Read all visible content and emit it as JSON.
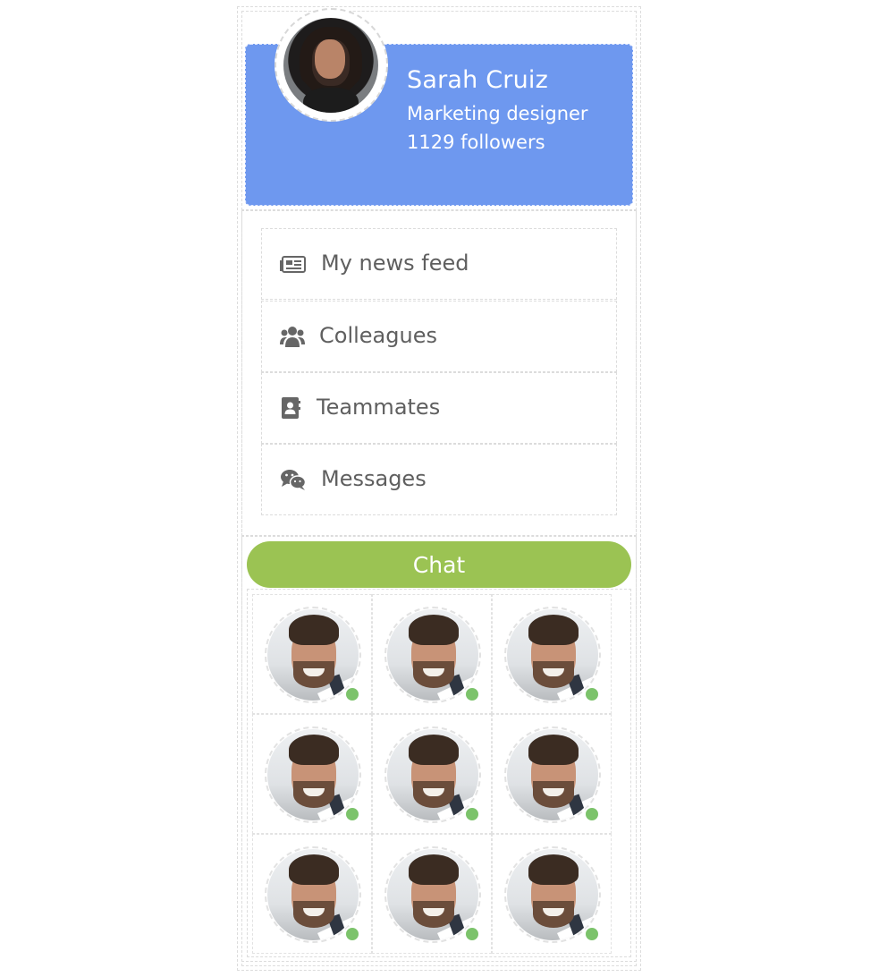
{
  "profile": {
    "name": "Sarah Cruiz",
    "role": "Marketing designer",
    "followers": "1129 followers"
  },
  "menu": {
    "items": [
      {
        "label": "My news feed",
        "icon": "newspaper-icon"
      },
      {
        "label": "Colleagues",
        "icon": "users-icon"
      },
      {
        "label": "Teammates",
        "icon": "contact-book-icon"
      },
      {
        "label": "Messages",
        "icon": "wechat-icon"
      }
    ]
  },
  "chat": {
    "button_label": "Chat",
    "contacts": [
      {
        "status": "online"
      },
      {
        "status": "online"
      },
      {
        "status": "online"
      },
      {
        "status": "online"
      },
      {
        "status": "online"
      },
      {
        "status": "online"
      },
      {
        "status": "online"
      },
      {
        "status": "online"
      },
      {
        "status": "online"
      }
    ]
  },
  "colors": {
    "header_bg": "#6e98ef",
    "chat_button": "#9bc353",
    "online": "#7cc36b",
    "text": "#5f5f5f"
  }
}
